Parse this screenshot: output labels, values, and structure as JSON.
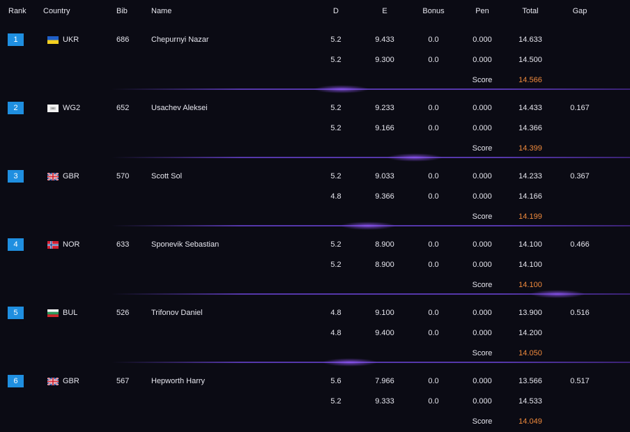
{
  "headers": {
    "rank": "Rank",
    "country": "Country",
    "bib": "Bib",
    "name": "Name",
    "d": "D",
    "e": "E",
    "bonus": "Bonus",
    "pen": "Pen",
    "total": "Total",
    "gap": "Gap"
  },
  "colors": {
    "background": "#0b0b14",
    "rank_badge": "#1f8fe0",
    "score_value": "#f08a3c",
    "divider": "#6e46dc"
  },
  "score_label": "Score",
  "athletes": [
    {
      "rank": "1",
      "flag": "ukraine-flag-icon",
      "country": "UKR",
      "bib": "686",
      "name": "Chepurnyi Nazar",
      "gap": "",
      "runs": [
        {
          "d": "5.2",
          "e": "9.433",
          "bonus": "0.0",
          "pen": "0.000",
          "total": "14.633"
        },
        {
          "d": "5.2",
          "e": "9.300",
          "bonus": "0.0",
          "pen": "0.000",
          "total": "14.500"
        }
      ],
      "score": "14.566"
    },
    {
      "rank": "2",
      "flag": "wg2-flag-icon",
      "country": "WG2",
      "bib": "652",
      "name": "Usachev Aleksei",
      "gap": "0.167",
      "runs": [
        {
          "d": "5.2",
          "e": "9.233",
          "bonus": "0.0",
          "pen": "0.000",
          "total": "14.433"
        },
        {
          "d": "5.2",
          "e": "9.166",
          "bonus": "0.0",
          "pen": "0.000",
          "total": "14.366"
        }
      ],
      "score": "14.399"
    },
    {
      "rank": "3",
      "flag": "uk-flag-icon",
      "country": "GBR",
      "bib": "570",
      "name": "Scott Sol",
      "gap": "0.367",
      "runs": [
        {
          "d": "5.2",
          "e": "9.033",
          "bonus": "0.0",
          "pen": "0.000",
          "total": "14.233"
        },
        {
          "d": "4.8",
          "e": "9.366",
          "bonus": "0.0",
          "pen": "0.000",
          "total": "14.166"
        }
      ],
      "score": "14.199"
    },
    {
      "rank": "4",
      "flag": "norway-flag-icon",
      "country": "NOR",
      "bib": "633",
      "name": "Sponevik Sebastian",
      "gap": "0.466",
      "runs": [
        {
          "d": "5.2",
          "e": "8.900",
          "bonus": "0.0",
          "pen": "0.000",
          "total": "14.100"
        },
        {
          "d": "5.2",
          "e": "8.900",
          "bonus": "0.0",
          "pen": "0.000",
          "total": "14.100"
        }
      ],
      "score": "14.100"
    },
    {
      "rank": "5",
      "flag": "bulgaria-flag-icon",
      "country": "BUL",
      "bib": "526",
      "name": "Trifonov Daniel",
      "gap": "0.516",
      "runs": [
        {
          "d": "4.8",
          "e": "9.100",
          "bonus": "0.0",
          "pen": "0.000",
          "total": "13.900"
        },
        {
          "d": "4.8",
          "e": "9.400",
          "bonus": "0.0",
          "pen": "0.000",
          "total": "14.200"
        }
      ],
      "score": "14.050"
    },
    {
      "rank": "6",
      "flag": "uk-flag-icon",
      "country": "GBR",
      "bib": "567",
      "name": "Hepworth Harry",
      "gap": "0.517",
      "runs": [
        {
          "d": "5.6",
          "e": "7.966",
          "bonus": "0.0",
          "pen": "0.000",
          "total": "13.566"
        },
        {
          "d": "5.2",
          "e": "9.333",
          "bonus": "0.0",
          "pen": "0.000",
          "total": "14.533"
        }
      ],
      "score": "14.049"
    }
  ]
}
